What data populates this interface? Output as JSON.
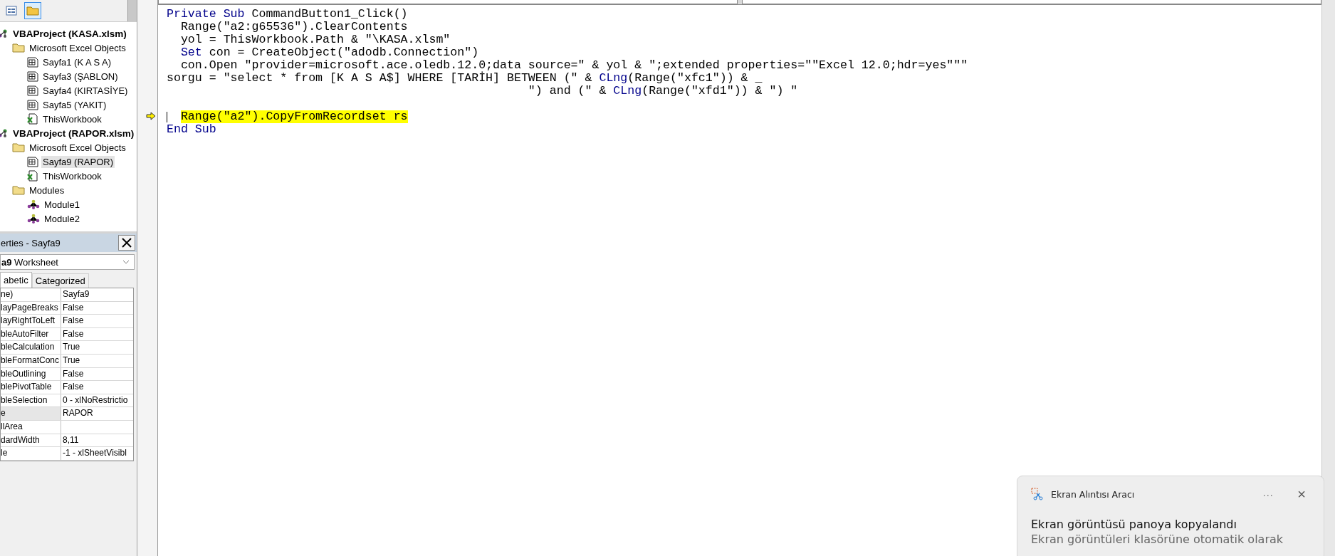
{
  "project_explorer": {
    "toolbar": [
      {
        "kind": "view",
        "selected": false
      },
      {
        "kind": "folders",
        "selected": true
      }
    ],
    "tree": [
      {
        "label": "VBAProject (KASA.xlsm)",
        "kind": "project",
        "selected": false,
        "children": [
          {
            "label": "Microsoft Excel Objects",
            "kind": "folder",
            "selected": false,
            "children": [
              {
                "label": "Sayfa1 (K A S A)",
                "kind": "sheet",
                "selected": false
              },
              {
                "label": "Sayfa3 (ŞABLON)",
                "kind": "sheet",
                "selected": false
              },
              {
                "label": "Sayfa4 (KIRTASİYE)",
                "kind": "sheet",
                "selected": false
              },
              {
                "label": "Sayfa5 (YAKIT)",
                "kind": "sheet",
                "selected": false
              },
              {
                "label": "ThisWorkbook",
                "kind": "workbook",
                "selected": false
              }
            ]
          }
        ]
      },
      {
        "label": "VBAProject (RAPOR.xlsm)",
        "kind": "project",
        "selected": false,
        "children": [
          {
            "label": "Microsoft Excel Objects",
            "kind": "folder",
            "selected": false,
            "children": [
              {
                "label": "Sayfa9 (RAPOR)",
                "kind": "sheet",
                "selected": true
              },
              {
                "label": "ThisWorkbook",
                "kind": "workbook",
                "selected": false
              }
            ]
          },
          {
            "label": "Modules",
            "kind": "folder",
            "selected": false,
            "children": [
              {
                "label": "Module1",
                "kind": "module",
                "selected": false
              },
              {
                "label": "Module2",
                "kind": "module",
                "selected": false
              }
            ]
          }
        ]
      }
    ]
  },
  "properties": {
    "title": "erties - Sayfa9",
    "object": "**a9** Worksheet",
    "tabs": [
      {
        "label": "abetic",
        "selected": true
      },
      {
        "label": "Categorized",
        "selected": false
      }
    ],
    "rows": [
      {
        "name": "ne)",
        "value": "Sayfa9",
        "selected": false
      },
      {
        "name": "layPageBreaks",
        "value": "False",
        "selected": false
      },
      {
        "name": "layRightToLeft",
        "value": "False",
        "selected": false
      },
      {
        "name": "bleAutoFilter",
        "value": "False",
        "selected": false
      },
      {
        "name": "bleCalculation",
        "value": "True",
        "selected": false
      },
      {
        "name": "bleFormatConc",
        "value": "True",
        "selected": false
      },
      {
        "name": "bleOutlining",
        "value": "False",
        "selected": false
      },
      {
        "name": "blePivotTable",
        "value": "False",
        "selected": false
      },
      {
        "name": "bleSelection",
        "value": "0 - xlNoRestrictio",
        "selected": false
      },
      {
        "name": "e",
        "value": "RAPOR",
        "selected": true
      },
      {
        "name": "llArea",
        "selected": false
      },
      {
        "name": "dardWidth",
        "value": "8,11",
        "selected": false
      },
      {
        "name": "le",
        "value": "-1 - xlSheetVisibl",
        "selected": false
      }
    ]
  },
  "code": {
    "lines": [
      {
        "current": false,
        "segments": [
          {
            "text": "Private Sub",
            "kind": "keyword"
          },
          {
            "text": " CommandButton1_Click()",
            "kind": "plain"
          }
        ]
      },
      {
        "current": false,
        "segments": [
          {
            "text": "  Range(\"a2:g65536\").ClearContents",
            "kind": "plain"
          }
        ]
      },
      {
        "current": false,
        "segments": [
          {
            "text": "  yol = ThisWorkbook.Path & \"\\KASA.xlsm\"",
            "kind": "plain"
          }
        ]
      },
      {
        "current": false,
        "segments": [
          {
            "text": "  Set",
            "kind": "keyword"
          },
          {
            "text": " con = CreateObject(\"adodb.Connection\")",
            "kind": "plain"
          }
        ]
      },
      {
        "current": false,
        "segments": [
          {
            "text": "  con.Open \"provider=microsoft.ace.oledb.12.0;data source=\" & yol & \";extended properties=\"\"Excel 12.0;hdr=yes\"\"\"",
            "kind": "plain"
          }
        ]
      },
      {
        "current": false,
        "segments": [
          {
            "text": "sorgu = \"select * from [K A S A$] WHERE [TARİH] BETWEEN (\" & ",
            "kind": "plain"
          },
          {
            "text": "CLng",
            "kind": "keyword"
          },
          {
            "text": "(Range(\"xfc1\")) & _",
            "kind": "plain"
          }
        ]
      },
      {
        "current": false,
        "segments": [
          {
            "text": "                                                   \") and (\" & ",
            "kind": "plain"
          },
          {
            "text": "CLng",
            "kind": "keyword"
          },
          {
            "text": "(Range(\"xfd1\")) & \") \"",
            "kind": "plain"
          }
        ]
      },
      {
        "current": false
      },
      {
        "current": true,
        "indented": true,
        "segments": [
          {
            "text": "Range(\"a2\").CopyFromRecordset rs",
            "kind": "highlight"
          }
        ]
      },
      {
        "current": false,
        "segments": [
          {
            "text": "End Sub",
            "kind": "keyword"
          }
        ]
      }
    ]
  },
  "notification": {
    "app": "Ekran Alıntısı Aracı",
    "more": "···",
    "close": "×",
    "title": "Ekran görüntüsü panoya kopyalandı",
    "body": "Ekran görüntüleri klasörüne otomatik olarak"
  }
}
